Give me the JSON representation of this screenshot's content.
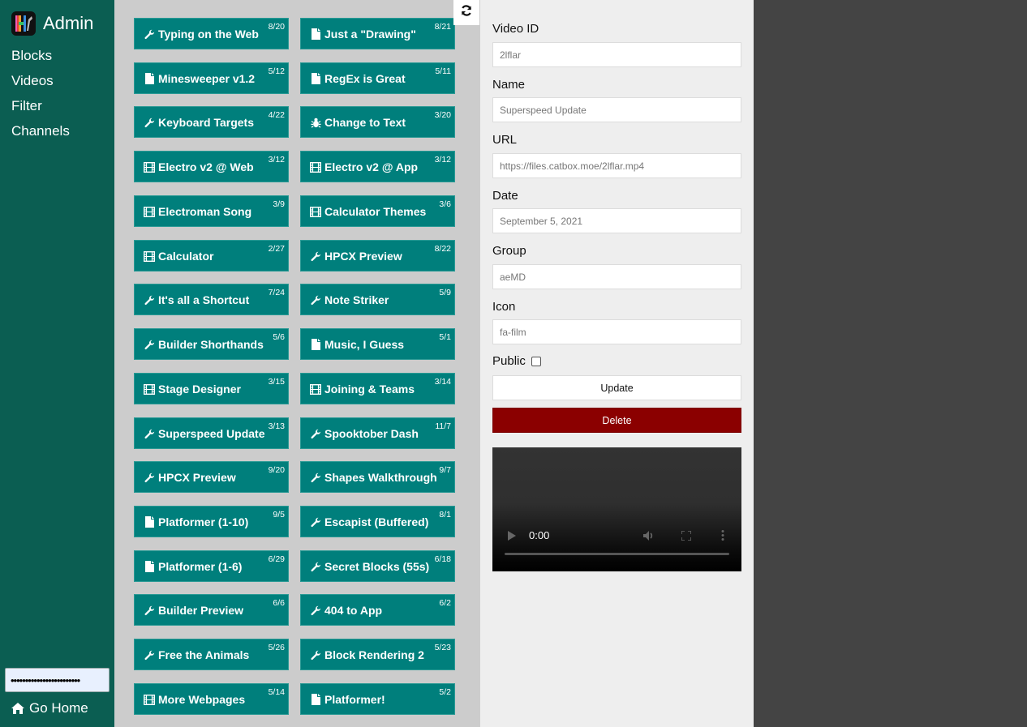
{
  "sidebar": {
    "title": "Admin",
    "logo_icon": "hackmud-logo-icon",
    "nav": [
      {
        "label": "Blocks"
      },
      {
        "label": "Videos"
      },
      {
        "label": "Filter"
      },
      {
        "label": "Channels"
      }
    ],
    "password_value": "••••••••••••••••••••••••",
    "go_home_label": "Go Home",
    "go_home_icon": "home-icon"
  },
  "list": {
    "refresh_icon": "refresh-icon",
    "cards": [
      {
        "icon": "wrench",
        "label": "Typing on the Web",
        "count": "8/20"
      },
      {
        "icon": "file",
        "label": "Just a \"Drawing\"",
        "count": "8/21"
      },
      {
        "icon": "file",
        "label": "Minesweeper v1.2",
        "count": "5/12"
      },
      {
        "icon": "file",
        "label": "RegEx is Great",
        "count": "5/11"
      },
      {
        "icon": "wrench",
        "label": "Keyboard Targets",
        "count": "4/22"
      },
      {
        "icon": "bug",
        "label": "Change to Text",
        "count": "3/20"
      },
      {
        "icon": "film",
        "label": "Electro v2 @ Web",
        "count": "3/12"
      },
      {
        "icon": "film",
        "label": "Electro v2 @ App",
        "count": "3/12"
      },
      {
        "icon": "film",
        "label": "Electroman Song",
        "count": "3/9"
      },
      {
        "icon": "film",
        "label": "Calculator Themes",
        "count": "3/6"
      },
      {
        "icon": "film",
        "label": "Calculator",
        "count": "2/27"
      },
      {
        "icon": "wrench",
        "label": "HPCX Preview",
        "count": "8/22"
      },
      {
        "icon": "wrench",
        "label": "It's all a Shortcut",
        "count": "7/24"
      },
      {
        "icon": "wrench",
        "label": "Note Striker",
        "count": "5/9"
      },
      {
        "icon": "wrench",
        "label": "Builder Shorthands",
        "count": "5/6"
      },
      {
        "icon": "file",
        "label": "Music, I Guess",
        "count": "5/1"
      },
      {
        "icon": "film",
        "label": "Stage Designer",
        "count": "3/15"
      },
      {
        "icon": "film",
        "label": "Joining & Teams",
        "count": "3/14"
      },
      {
        "icon": "wrench",
        "label": "Superspeed Update",
        "count": "3/13"
      },
      {
        "icon": "wrench",
        "label": "Spooktober Dash",
        "count": "11/7"
      },
      {
        "icon": "wrench",
        "label": "HPCX Preview",
        "count": "9/20"
      },
      {
        "icon": "wrench",
        "label": "Shapes Walkthrough",
        "count": "9/7"
      },
      {
        "icon": "file",
        "label": "Platformer (1-10)",
        "count": "9/5"
      },
      {
        "icon": "wrench",
        "label": "Escapist (Buffered)",
        "count": "8/1"
      },
      {
        "icon": "file",
        "label": "Platformer (1-6)",
        "count": "6/29"
      },
      {
        "icon": "wrench",
        "label": "Secret Blocks (55s)",
        "count": "6/18"
      },
      {
        "icon": "wrench",
        "label": "Builder Preview",
        "count": "6/6"
      },
      {
        "icon": "wrench",
        "label": "404 to App",
        "count": "6/2"
      },
      {
        "icon": "wrench",
        "label": "Free the Animals",
        "count": "5/26"
      },
      {
        "icon": "wrench",
        "label": "Block Rendering 2",
        "count": "5/23"
      },
      {
        "icon": "film",
        "label": "More Webpages",
        "count": "5/14"
      },
      {
        "icon": "file",
        "label": "Platformer!",
        "count": "5/2"
      }
    ]
  },
  "form": {
    "fields": [
      {
        "label": "Video ID",
        "value": "2lflar"
      },
      {
        "label": "Name",
        "value": "Superspeed Update"
      },
      {
        "label": "URL",
        "value": "https://files.catbox.moe/2lflar.mp4"
      },
      {
        "label": "Date",
        "value": "September 5, 2021"
      },
      {
        "label": "Group",
        "value": "aeMD"
      },
      {
        "label": "Icon",
        "value": "fa-film"
      }
    ],
    "public_label": "Public",
    "public_checked": false,
    "update_label": "Update",
    "delete_label": "Delete",
    "video": {
      "time": "0:00",
      "progress_fraction": 0
    }
  },
  "colors": {
    "sidebar": "#0b5e52",
    "card": "#007f7c",
    "delete": "#8b0000",
    "list_bg": "#cccccc",
    "form_bg": "#eeeeee",
    "backdrop": "#444444"
  }
}
